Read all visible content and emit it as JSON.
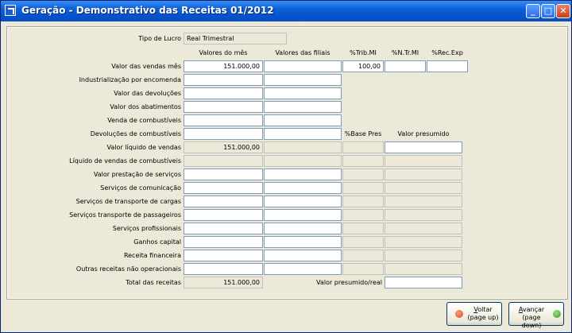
{
  "window": {
    "title": "Geração - Demonstrativo das Receitas 01/2012"
  },
  "tipo_lucro": {
    "label": "Tipo de Lucro",
    "value": "Real Trimestral"
  },
  "headers": {
    "valores_mes": "Valores do mês",
    "valores_filiais": "Valores das filiais",
    "trib_mi": "%Trib.MI",
    "n_tr_mi": "%N.Tr.MI",
    "rec_exp": "%Rec.Exp",
    "base_pres": "%Base Pres",
    "valor_presumido": "Valor presumido"
  },
  "rows": [
    {
      "label": "Valor das vendas mês",
      "mes": "151.000,00",
      "filiais": "",
      "trib": "100,00",
      "ntr": "",
      "rec": ""
    },
    {
      "label": "Industrialização por encomenda",
      "mes": "",
      "filiais": ""
    },
    {
      "label": "Valor das devoluções",
      "mes": "",
      "filiais": ""
    },
    {
      "label": "Valor dos abatimentos",
      "mes": "",
      "filiais": ""
    },
    {
      "label": "Venda de combustíveis",
      "mes": "",
      "filiais": ""
    },
    {
      "label": "Devoluções de combustíveis",
      "mes": "",
      "filiais": ""
    },
    {
      "label": "Valor líquido de vendas",
      "mes": "151.000,00",
      "filiais": "",
      "base": "",
      "presumido": ""
    },
    {
      "label": "Líquido de vendas de combustíveis",
      "mes": "",
      "filiais": "",
      "base": "",
      "presumido": ""
    },
    {
      "label": "Valor prestação de serviços",
      "mes": "",
      "filiais": "",
      "base": "",
      "presumido": ""
    },
    {
      "label": "Serviços de comunicação",
      "mes": "",
      "filiais": "",
      "base": "",
      "presumido": ""
    },
    {
      "label": "Serviços de transporte de cargas",
      "mes": "",
      "filiais": "",
      "base": "",
      "presumido": ""
    },
    {
      "label": "Serviços transporte de passageiros",
      "mes": "",
      "filiais": "",
      "base": "",
      "presumido": ""
    },
    {
      "label": "Serviços profissionais",
      "mes": "",
      "filiais": "",
      "base": "",
      "presumido": ""
    },
    {
      "label": "Ganhos capital",
      "mes": "",
      "filiais": "",
      "base": "",
      "presumido": ""
    },
    {
      "label": "Receita financeira",
      "mes": "",
      "filiais": "",
      "base": "",
      "presumido": ""
    },
    {
      "label": "Outras receitas não operacionais",
      "mes": "",
      "filiais": "",
      "base": "",
      "presumido": ""
    },
    {
      "label": "Total das receitas",
      "mes": "151.000,00"
    }
  ],
  "valor_presumido_real": {
    "label": "Valor presumido/real",
    "value": ""
  },
  "buttons": {
    "voltar_underlined": "V",
    "voltar_rest": "oltar",
    "voltar_hint": "(page up)",
    "avancar_underlined": "A",
    "avancar_rest": "vançar",
    "avancar_hint": "(page down)"
  },
  "colors": {
    "titlebar": "#0a5fd8",
    "voltar_icon": "#d94a2a",
    "avancar_icon": "#3a9a2a"
  }
}
